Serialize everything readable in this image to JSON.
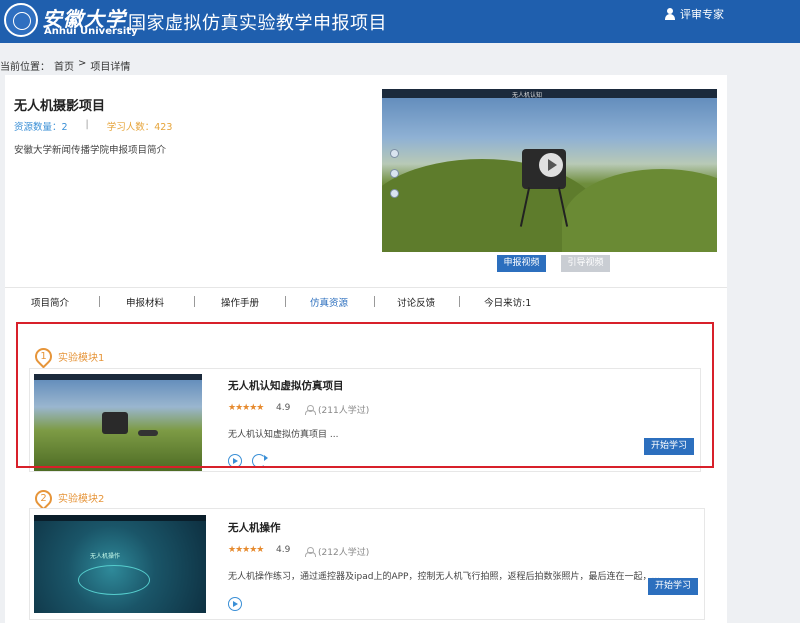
{
  "header": {
    "logo_cn": "安徽大学",
    "logo_en": "Anhui University",
    "site_title": "国家虚拟仿真实验教学申报项目",
    "user_link": "评审专家"
  },
  "breadcrumb": {
    "prefix": "当前位置：",
    "home": "首页",
    "separator": ">",
    "current": "项目详情"
  },
  "project": {
    "title": "无人机摄影项目",
    "resources_label": "资源数量：2",
    "separator": "|",
    "learners_label": "学习人数：423",
    "description": "安徽大学新闻传播学院申报项目简介",
    "video_title": "无人机认知",
    "buttons": {
      "report_video": "申报视频",
      "guide_video": "引导视频"
    }
  },
  "tabs": [
    {
      "label": "项目简介"
    },
    {
      "label": "申报材料"
    },
    {
      "label": "操作手册"
    },
    {
      "label": "仿真资源"
    },
    {
      "label": "讨论反馈"
    },
    {
      "label": "今日来访:1"
    }
  ],
  "modules": [
    {
      "number": "1",
      "label": "实验模块1",
      "title": "无人机认知虚拟仿真项目",
      "stars": "★★★★★",
      "rating": "4.9",
      "learners": "(211人学过)",
      "description": "无人机认知虚拟仿真项目 ...",
      "start_label": "开始学习"
    },
    {
      "number": "2",
      "label": "实验模块2",
      "title": "无人机操作",
      "stars": "★★★★★",
      "rating": "4.9",
      "learners": "(212人学过)",
      "description": "无人机操作练习，通过遥控器及ipad上的APP，控制无人机飞行拍照，返程后拍数张照片，最后连在一起，...",
      "thumb_title": "无人机操作",
      "start_label": "开始学习"
    }
  ],
  "colors": {
    "header_blue": "#1f5fae",
    "accent_orange": "#e6953a",
    "button_blue": "#2c6fbe",
    "highlight_red": "#d8202a",
    "stat_blue": "#3a8fd6"
  }
}
